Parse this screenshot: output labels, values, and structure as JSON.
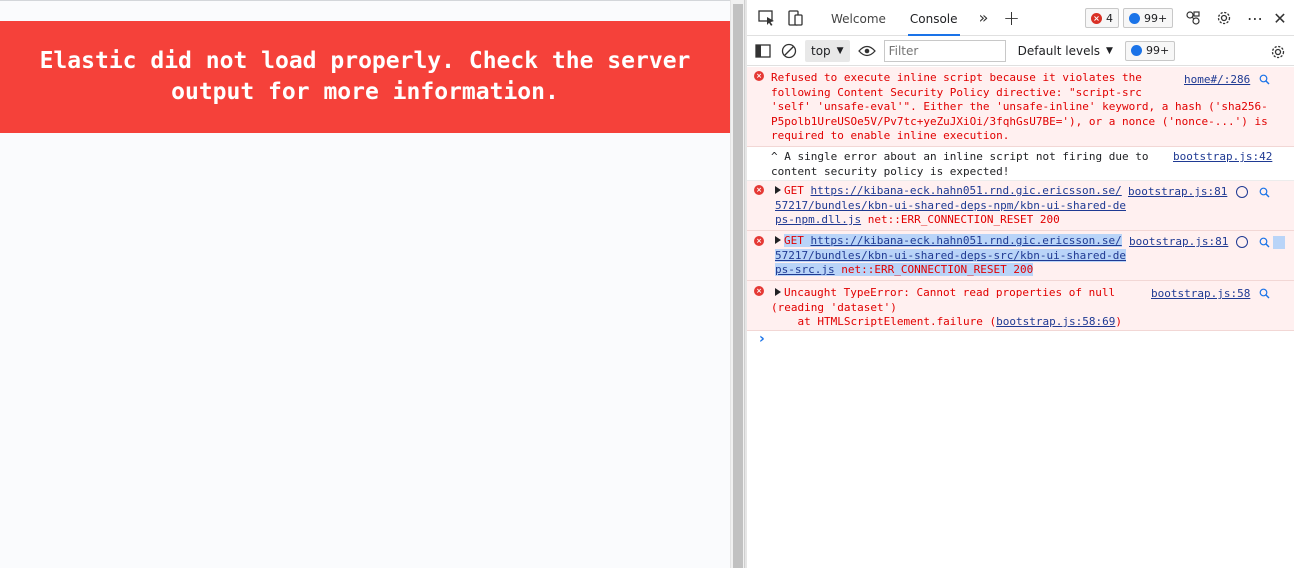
{
  "page": {
    "error_text_line1": "Elastic did not load properly. Check the server",
    "error_text_line2": "output for more information.",
    "banner_color": "#f5413a"
  },
  "devtools": {
    "tabs": [
      {
        "label": "Welcome",
        "active": false
      },
      {
        "label": "Console",
        "active": true
      }
    ],
    "error_count": "4",
    "message_count": "99+",
    "toolbar": {
      "context": "top",
      "filter_placeholder": "Filter",
      "levels_label": "Default levels",
      "issues_count": "99+"
    },
    "messages": [
      {
        "type": "error",
        "lines": [
          "Refused to execute inline script because it violates the",
          "following Content Security Policy directive: \"script-src",
          "'self' 'unsafe-eval'\". Either the 'unsafe-inline' keyword, a hash ('sha256-",
          "P5polb1UreUSOe5V/Pv7tc+yeZuJXiOi/3fqhGsU7BE='), or a nonce ('nonce-...') is",
          "required to enable inline execution."
        ],
        "source": "home#/:286"
      },
      {
        "type": "info",
        "lines": [
          "^ A single error about an inline script not firing due to",
          "content security policy is expected!"
        ],
        "source": "bootstrap.js:42"
      },
      {
        "type": "error",
        "method": "GET",
        "url_lines": [
          "https://kibana-eck.hahn051.rnd.gic.ericsson.se/",
          "57217/bundles/kbn-ui-shared-deps-npm/kbn-ui-shared-de",
          "ps-npm.dll.js"
        ],
        "status": "net::ERR_CONNECTION_RESET 200",
        "source": "bootstrap.js:81"
      },
      {
        "type": "error",
        "method": "GET",
        "url_lines": [
          "https://kibana-eck.hahn051.rnd.gic.ericsson.se/",
          "57217/bundles/kbn-ui-shared-deps-src/kbn-ui-shared-de",
          "ps-src.js"
        ],
        "status": "net::ERR_CONNECTION_RESET 200",
        "source": "bootstrap.js:81",
        "highlighted": true
      },
      {
        "type": "error",
        "lines": [
          "Uncaught TypeError: Cannot read properties of null",
          "(reading 'dataset')"
        ],
        "stack_prefix": "    at HTMLScriptElement.failure (",
        "stack_link": "bootstrap.js:58:69",
        "stack_suffix": ")",
        "source": "bootstrap.js:58"
      }
    ]
  }
}
